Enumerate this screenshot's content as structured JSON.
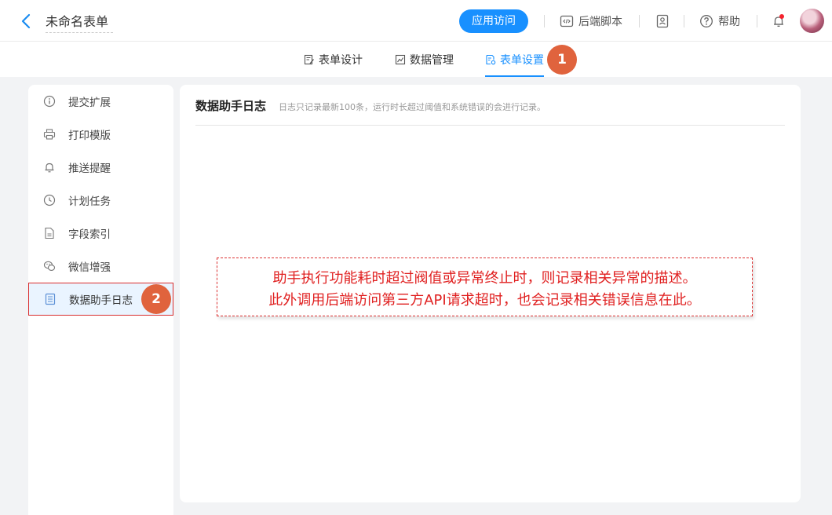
{
  "header": {
    "form_title": "未命名表单",
    "app_access": "应用访问",
    "backend_script": "后端脚本",
    "help": "帮助"
  },
  "tabs": [
    {
      "label": "表单设计",
      "icon": "form-edit-icon",
      "active": false
    },
    {
      "label": "数据管理",
      "icon": "chart-icon",
      "active": false
    },
    {
      "label": "表单设置",
      "icon": "form-settings-icon",
      "active": true
    }
  ],
  "badges": [
    "1",
    "2"
  ],
  "sidebar": {
    "items": [
      {
        "label": "提交扩展",
        "icon": "info-icon"
      },
      {
        "label": "打印模版",
        "icon": "printer-icon"
      },
      {
        "label": "推送提醒",
        "icon": "bell-icon"
      },
      {
        "label": "计划任务",
        "icon": "clock-icon"
      },
      {
        "label": "字段索引",
        "icon": "file-icon"
      },
      {
        "label": "微信增强",
        "icon": "wechat-icon"
      },
      {
        "label": "数据助手日志",
        "icon": "log-icon",
        "active": true
      }
    ]
  },
  "main": {
    "title": "数据助手日志",
    "description": "日志只记录最新100条，运行时长超过阈值和系统错误的会进行记录。",
    "note_line1": "助手执行功能耗时超过阀值或异常终止时，则记录相关异常的描述。",
    "note_line2": "此外调用后端访问第三方API请求超时，也会记录相关错误信息在此。"
  },
  "colors": {
    "accent": "#1890ff",
    "badge": "#e0633d",
    "note_red": "#e02020"
  }
}
